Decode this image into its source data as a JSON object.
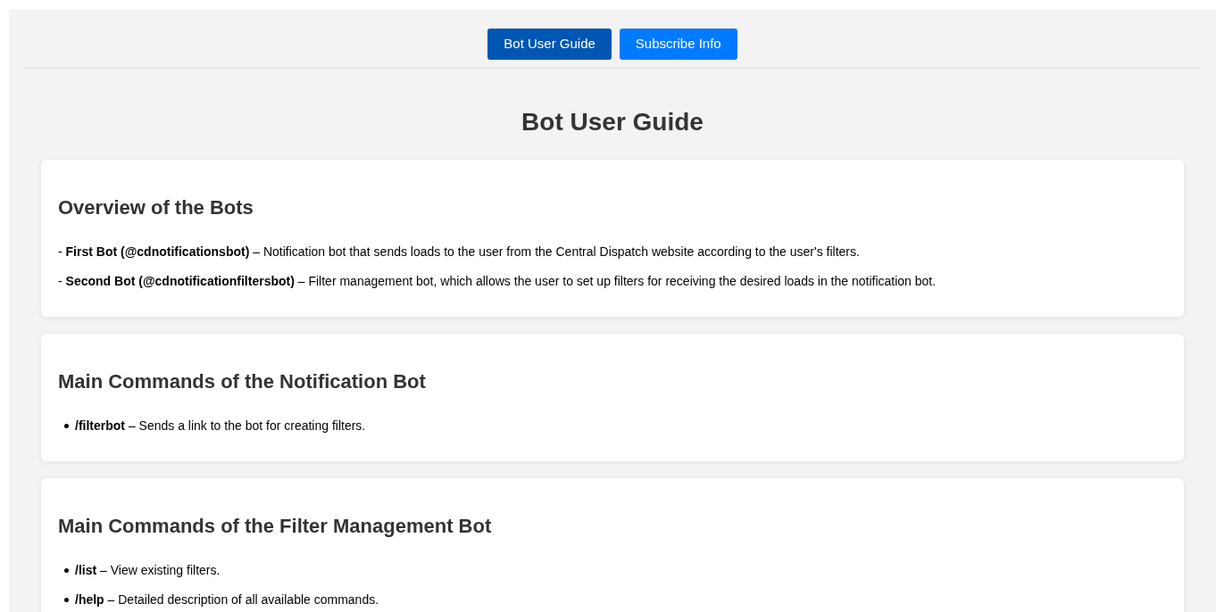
{
  "tabs": [
    {
      "label": "Bot User Guide",
      "selected": true
    },
    {
      "label": "Subscribe Info",
      "selected": false
    }
  ],
  "page_title": "Bot User Guide",
  "sections": [
    {
      "heading": "Overview of the Bots",
      "kind": "paragraphs",
      "items": [
        "- **First Bot (@cdnotificationsbot)** – Notification bot that sends loads to the user from the Central Dispatch website according to the user's filters.",
        "- **Second Bot (@cdnotificationfiltersbot)** – Filter management bot, which allows the user to set up filters for receiving the desired loads in the notification bot."
      ]
    },
    {
      "heading": "Main Commands of the Notification Bot",
      "kind": "bullets",
      "items": [
        "**/filterbot** – Sends a link to the bot for creating filters."
      ]
    },
    {
      "heading": "Main Commands of the Filter Management Bot",
      "kind": "bullets",
      "items": [
        "**/list** – View existing filters.",
        "**/help** – Detailed description of all available commands."
      ]
    }
  ]
}
